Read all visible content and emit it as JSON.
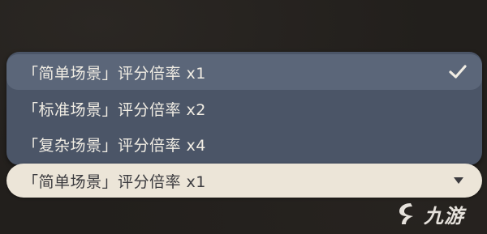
{
  "dropdown": {
    "options": [
      {
        "label": "「简单场景」评分倍率 x1",
        "selected": true
      },
      {
        "label": "「标准场景」评分倍率 x2",
        "selected": false
      },
      {
        "label": "「复杂场景」评分倍率 x4",
        "selected": false
      }
    ],
    "selected_icon": "checkmark-icon"
  },
  "select": {
    "value": "「简单场景」评分倍率 x1",
    "icon": "caret-down-icon"
  },
  "watermark": {
    "text": "九游",
    "icon": "jiuyou-logo-icon"
  },
  "colors": {
    "menu_bg": "#4b5567",
    "menu_selected_bg": "#5b6679",
    "option_text": "#f1ede4",
    "select_bg": "#ece5d8",
    "select_text": "#3b3b3f",
    "page_bg": "#221f1c"
  }
}
